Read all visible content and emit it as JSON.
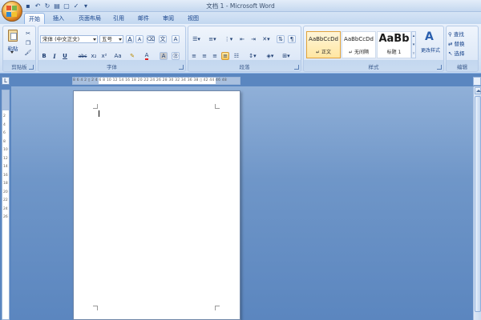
{
  "window": {
    "title": "文档 1 - Microsoft Word"
  },
  "tabs": [
    {
      "label": "开始",
      "active": true
    },
    {
      "label": "插入"
    },
    {
      "label": "页面布局"
    },
    {
      "label": "引用"
    },
    {
      "label": "邮件"
    },
    {
      "label": "审阅"
    },
    {
      "label": "视图"
    }
  ],
  "ribbon": {
    "clipboard": {
      "label": "剪贴板",
      "paste": "粘贴"
    },
    "font": {
      "label": "字体",
      "font_name": "宋体 (中文正文)",
      "font_size": "五号",
      "bold": "B",
      "italic": "I",
      "underline": "U",
      "strikethrough": "abc",
      "subscript": "x₂",
      "superscript": "x²",
      "change_case": "Aa",
      "font_color": "A",
      "grow": "A",
      "shrink": "A"
    },
    "paragraph": {
      "label": "段落"
    },
    "styles": {
      "label": "样式",
      "items": [
        {
          "sample": "AaBbCcDd",
          "name": "↵ 正文",
          "selected": true
        },
        {
          "sample": "AaBbCcDd",
          "name": "↵ 无间隔"
        },
        {
          "sample": "AaBb",
          "name": "标题 1"
        }
      ],
      "change_styles": "更改样式"
    },
    "editing": {
      "label": "编辑",
      "find": "查找",
      "replace": "替换",
      "select": "选择"
    }
  },
  "ruler": {
    "h_numbers": "8  6  4  2  ▯  2  4  6  8  10 12 14 16 18 20 22 24 26 28 30 32 34 36 38 ▯ 42 44 46 48",
    "v_numbers": "2 4 6 8 10 12 14 16 18 20 22 24 26"
  },
  "colors": {
    "ribbon_bg": "#dbe7f7",
    "workspace": "#6f96c8",
    "accent_text": "#15428b",
    "selected_style": "#ffe6a2"
  }
}
